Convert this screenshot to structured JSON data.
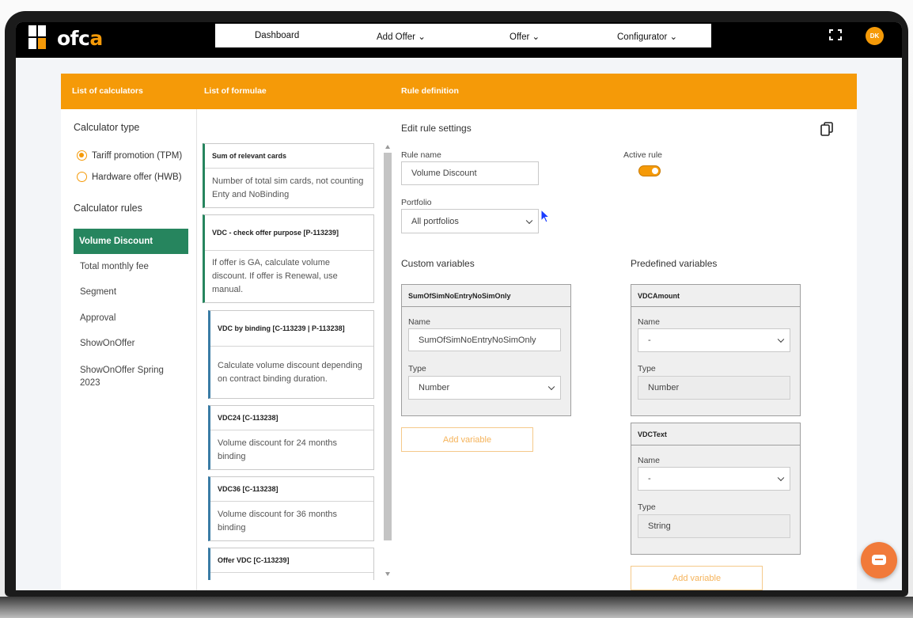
{
  "app": {
    "logo_text": "ofc",
    "logo_accent": "a",
    "user_initials": "DK"
  },
  "nav": {
    "items": [
      "Dashboard",
      "Add Offer ⌄",
      "Offer ⌄",
      "Configurator ⌄"
    ]
  },
  "header": {
    "col1": "List of calculators",
    "col2": "List of formulae",
    "col3": "Rule definition"
  },
  "calculators": {
    "type_heading": "Calculator type",
    "type_options": [
      "Tariff promotion (TPM)",
      "Hardware offer (HWB)"
    ],
    "selected_type": "Tariff promotion (TPM)",
    "rules_heading": "Calculator rules",
    "rules": [
      "Volume Discount",
      "Total monthly fee",
      "Segment",
      "Approval",
      "ShowOnOffer",
      "ShowOnOffer Spring 2023"
    ],
    "active_rule": "Volume Discount"
  },
  "formulae": [
    {
      "title": "Sum of relevant cards",
      "desc": "Number of total sim cards, not counting Enty and NoBinding"
    },
    {
      "title": "VDC - check offer purpose [P-113239]",
      "desc": "If offer is GA, calculate volume discount. If offer is Renewal, use manual."
    },
    {
      "title": "VDC by binding [C-113239 | P-113238]",
      "desc": "Calculate volume discount depending on contract binding duration."
    },
    {
      "title": "VDC24 [C-113238]",
      "desc": "Volume discount for 24 months binding"
    },
    {
      "title": "VDC36 [C-113238]",
      "desc": "Volume discount for 36 months binding"
    },
    {
      "title": "Offer VDC [C-113239]",
      "desc": ""
    }
  ],
  "rule": {
    "heading": "Edit rule settings",
    "name_label": "Rule name",
    "name_value": "Volume Discount",
    "active_label": "Active rule",
    "active": true,
    "portfolio_label": "Portfolio",
    "portfolio_value": "All portfolios",
    "custom_heading": "Custom variables",
    "predefined_heading": "Predefined variables",
    "custom_vars": [
      {
        "title": "SumOfSimNoEntryNoSimOnly",
        "name_label": "Name",
        "name_value": "SumOfSimNoEntryNoSimOnly",
        "type_label": "Type",
        "type_value": "Number"
      }
    ],
    "predefined_vars": [
      {
        "title": "VDCAmount",
        "name_label": "Name",
        "name_value": "-",
        "type_label": "Type",
        "type_value": "Number"
      },
      {
        "title": "VDCText",
        "name_label": "Name",
        "name_value": "-",
        "type_label": "Type",
        "type_value": "String"
      }
    ],
    "add_variable_label": "Add variable"
  },
  "colors": {
    "accent": "#f59a08",
    "active_green": "#26855e",
    "chat": "#f17a3a"
  },
  "icons": [
    "fullscreen-icon",
    "copy-icon",
    "chat-icon",
    "chevron-down-icon"
  ]
}
